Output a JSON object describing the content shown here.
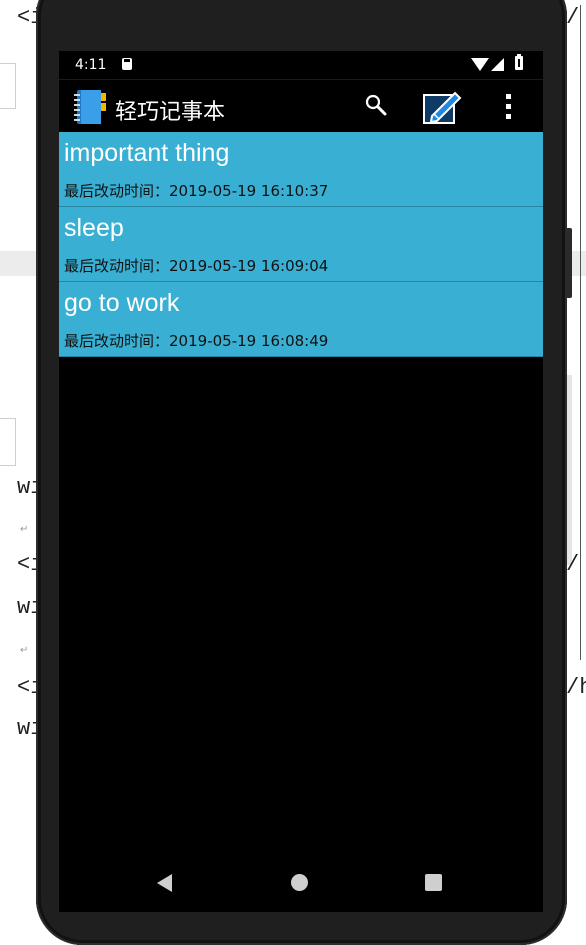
{
  "background_doc": {
    "lines": [
      {
        "left": "<i",
        "right": "/"
      },
      {
        "left": "wi",
        "right": ""
      },
      {
        "left": "<i",
        "right": "/"
      },
      {
        "left": "wi",
        "right": ""
      },
      {
        "left": "<i",
        "right": "/h"
      },
      {
        "left": "wi",
        "right": ""
      }
    ],
    "return_mark": "↵"
  },
  "status_bar": {
    "time": "4:11"
  },
  "app_bar": {
    "title": "轻巧记事本",
    "icons": [
      "notebook-app-icon",
      "search-icon",
      "edit-note-icon",
      "more-vert-icon"
    ]
  },
  "notes": [
    {
      "title": "important thing",
      "time_label": "最后改动时间：",
      "time": "2019-05-19 16:10:37"
    },
    {
      "title": "sleep",
      "time_label": "最后改动时间：",
      "time": "2019-05-19 16:09:04"
    },
    {
      "title": "go to work",
      "time_label": "最后改动时间：",
      "time": "2019-05-19 16:08:49"
    }
  ],
  "nav_bar": {
    "icons": [
      "back-icon",
      "home-icon",
      "recents-icon"
    ]
  },
  "colors": {
    "note_background": "#39b0d3",
    "screen_background": "#000000",
    "accent": "#1e88e5"
  }
}
